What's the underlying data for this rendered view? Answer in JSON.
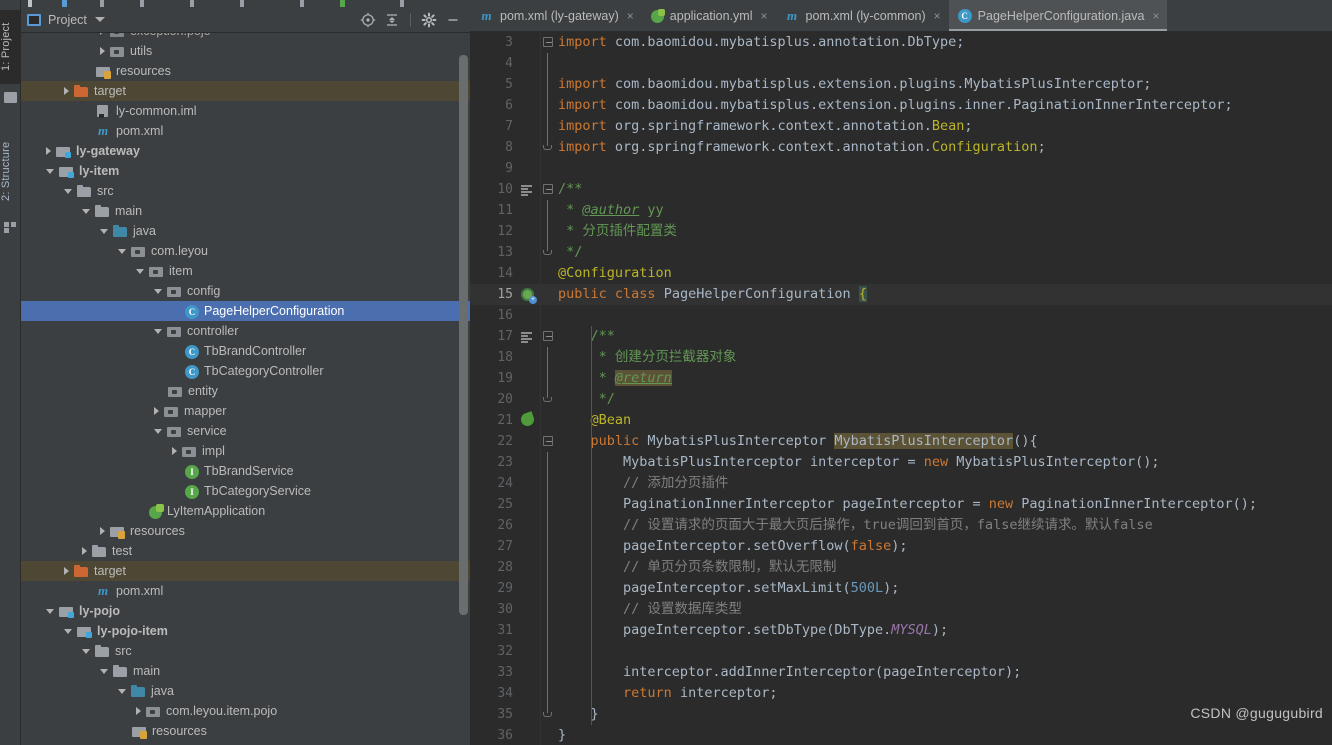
{
  "window": {
    "left_tool_strip": [
      {
        "label": "1: Project",
        "active": true,
        "icon": "project-icon"
      },
      {
        "label": "2: Structure",
        "active": false,
        "icon": "structure-icon"
      }
    ]
  },
  "project_panel": {
    "title": "Project",
    "dropdown_icon": "chevron-down-icon",
    "actions": [
      {
        "name": "locate-icon",
        "title": "Select Opened File"
      },
      {
        "name": "collapse-all-icon",
        "title": "Collapse All"
      },
      {
        "name": "gear-icon",
        "title": "Settings"
      },
      {
        "name": "minimize-icon",
        "title": "Hide"
      }
    ],
    "tree": [
      {
        "label": "exception.pojo",
        "indent": 4,
        "arrow": "right",
        "icon": "package",
        "clipped": true
      },
      {
        "label": "utils",
        "indent": 4,
        "arrow": "right",
        "icon": "package"
      },
      {
        "label": "resources",
        "indent": 3,
        "arrow": "none",
        "icon": "resources-folder"
      },
      {
        "label": "target",
        "indent": 2,
        "arrow": "right",
        "icon": "folder-orange",
        "highlight": "target"
      },
      {
        "label": "ly-common.iml",
        "indent": 3,
        "arrow": "none",
        "icon": "iml"
      },
      {
        "label": "pom.xml",
        "indent": 3,
        "arrow": "none",
        "icon": "maven"
      },
      {
        "label": "ly-gateway",
        "indent": 1,
        "arrow": "right",
        "icon": "module",
        "bold": true
      },
      {
        "label": "ly-item",
        "indent": 1,
        "arrow": "down",
        "icon": "module",
        "bold": true
      },
      {
        "label": "src",
        "indent": 2,
        "arrow": "down",
        "icon": "folder"
      },
      {
        "label": "main",
        "indent": 3,
        "arrow": "down",
        "icon": "folder"
      },
      {
        "label": "java",
        "indent": 4,
        "arrow": "down",
        "icon": "folder-blue"
      },
      {
        "label": "com.leyou",
        "indent": 5,
        "arrow": "down",
        "icon": "package"
      },
      {
        "label": "item",
        "indent": 6,
        "arrow": "down",
        "icon": "package"
      },
      {
        "label": "config",
        "indent": 7,
        "arrow": "down",
        "icon": "package"
      },
      {
        "label": "PageHelperConfiguration",
        "indent": 8,
        "arrow": "none",
        "icon": "class",
        "selected": true
      },
      {
        "label": "controller",
        "indent": 7,
        "arrow": "down",
        "icon": "package"
      },
      {
        "label": "TbBrandController",
        "indent": 8,
        "arrow": "none",
        "icon": "class"
      },
      {
        "label": "TbCategoryController",
        "indent": 8,
        "arrow": "none",
        "icon": "class"
      },
      {
        "label": "entity",
        "indent": 7,
        "arrow": "none",
        "icon": "package"
      },
      {
        "label": "mapper",
        "indent": 7,
        "arrow": "right",
        "icon": "package"
      },
      {
        "label": "service",
        "indent": 7,
        "arrow": "down",
        "icon": "package"
      },
      {
        "label": "impl",
        "indent": 8,
        "arrow": "right",
        "icon": "package"
      },
      {
        "label": "TbBrandService",
        "indent": 8,
        "arrow": "none",
        "icon": "interface"
      },
      {
        "label": "TbCategoryService",
        "indent": 8,
        "arrow": "none",
        "icon": "interface"
      },
      {
        "label": "LyItemApplication",
        "indent": 6,
        "arrow": "none",
        "icon": "spring-app"
      },
      {
        "label": "resources",
        "indent": 4,
        "arrow": "right",
        "icon": "resources-folder"
      },
      {
        "label": "test",
        "indent": 3,
        "arrow": "right",
        "icon": "folder"
      },
      {
        "label": "target",
        "indent": 2,
        "arrow": "right",
        "icon": "folder-orange",
        "highlight": "target"
      },
      {
        "label": "pom.xml",
        "indent": 3,
        "arrow": "none",
        "icon": "maven"
      },
      {
        "label": "ly-pojo",
        "indent": 1,
        "arrow": "down",
        "icon": "module",
        "bold": true
      },
      {
        "label": "ly-pojo-item",
        "indent": 2,
        "arrow": "down",
        "icon": "module",
        "bold": true
      },
      {
        "label": "src",
        "indent": 3,
        "arrow": "down",
        "icon": "folder"
      },
      {
        "label": "main",
        "indent": 4,
        "arrow": "down",
        "icon": "folder"
      },
      {
        "label": "java",
        "indent": 5,
        "arrow": "down",
        "icon": "folder-blue"
      },
      {
        "label": "com.leyou.item.pojo",
        "indent": 6,
        "arrow": "right",
        "icon": "package"
      },
      {
        "label": "resources",
        "indent": 5,
        "arrow": "none",
        "icon": "resources-folder"
      }
    ]
  },
  "editor": {
    "tabs": [
      {
        "label": "pom.xml (ly-gateway)",
        "icon": "maven-icon",
        "active": false,
        "close": "×"
      },
      {
        "label": "application.yml",
        "icon": "spring-yaml-icon",
        "active": false,
        "close": "×"
      },
      {
        "label": "pom.xml (ly-common)",
        "icon": "maven-icon",
        "active": false,
        "close": "×"
      },
      {
        "label": "PageHelperConfiguration.java",
        "icon": "java-class-icon",
        "active": true,
        "close": "×"
      }
    ],
    "first_line_number": 3,
    "current_line": 15,
    "lines": [
      {
        "n": 3,
        "text": "import com.baomidou.mybatisplus.annotation.DbType;"
      },
      {
        "n": 4,
        "text": ""
      },
      {
        "n": 5,
        "text": "import com.baomidou.mybatisplus.extension.plugins.MybatisPlusInterceptor;"
      },
      {
        "n": 6,
        "text": "import com.baomidou.mybatisplus.extension.plugins.inner.PaginationInnerInterceptor;"
      },
      {
        "n": 7,
        "text": "import org.springframework.context.annotation.Bean;"
      },
      {
        "n": 8,
        "text": "import org.springframework.context.annotation.Configuration;"
      },
      {
        "n": 9,
        "text": ""
      },
      {
        "n": 10,
        "text": "/**"
      },
      {
        "n": 11,
        "text": " * @author yy"
      },
      {
        "n": 12,
        "text": " * 分页插件配置类"
      },
      {
        "n": 13,
        "text": " */"
      },
      {
        "n": 14,
        "text": "@Configuration"
      },
      {
        "n": 15,
        "text": "public class PageHelperConfiguration {"
      },
      {
        "n": 16,
        "text": ""
      },
      {
        "n": 17,
        "text": "    /**"
      },
      {
        "n": 18,
        "text": "     * 创建分页拦截器对象"
      },
      {
        "n": 19,
        "text": "     * @return"
      },
      {
        "n": 20,
        "text": "     */"
      },
      {
        "n": 21,
        "text": "    @Bean"
      },
      {
        "n": 22,
        "text": "    public MybatisPlusInterceptor MybatisPlusInterceptor(){"
      },
      {
        "n": 23,
        "text": "        MybatisPlusInterceptor interceptor = new MybatisPlusInterceptor();"
      },
      {
        "n": 24,
        "text": "        // 添加分页插件"
      },
      {
        "n": 25,
        "text": "        PaginationInnerInterceptor pageInterceptor = new PaginationInnerInterceptor();"
      },
      {
        "n": 26,
        "text": "        // 设置请求的页面大于最大页后操作，true调回到首页，false继续请求。默认false"
      },
      {
        "n": 27,
        "text": "        pageInterceptor.setOverflow(false);"
      },
      {
        "n": 28,
        "text": "        // 单页分页条数限制，默认无限制"
      },
      {
        "n": 29,
        "text": "        pageInterceptor.setMaxLimit(500L);"
      },
      {
        "n": 30,
        "text": "        // 设置数据库类型"
      },
      {
        "n": 31,
        "text": "        pageInterceptor.setDbType(DbType.MYSQL);"
      },
      {
        "n": 32,
        "text": ""
      },
      {
        "n": 33,
        "text": "        interceptor.addInnerInterceptor(pageInterceptor);"
      },
      {
        "n": 34,
        "text": "        return interceptor;"
      },
      {
        "n": 35,
        "text": "    }"
      },
      {
        "n": 36,
        "text": "}"
      }
    ],
    "gutter_markers": [
      {
        "line": 15,
        "name": "spring-bean-component-marker"
      },
      {
        "line": 21,
        "name": "spring-bean-marker"
      },
      {
        "line": 10,
        "name": "javadoc-marker"
      },
      {
        "line": 17,
        "name": "javadoc-marker"
      }
    ]
  },
  "watermark": "CSDN @gugugubird",
  "colors": {
    "panel_bg": "#3c3f41",
    "editor_bg": "#2b2b2b",
    "selection_blue": "#4b6eaf",
    "target_highlight": "#4e4733",
    "keyword_orange": "#cc7832",
    "string_green": "#6a8759",
    "javadoc_green": "#629755",
    "annotation_yellow": "#bbb529",
    "number_blue": "#6897bb",
    "static_field_purple": "#9876aa",
    "comment_gray": "#808080",
    "text_default": "#a9b7c6",
    "search_highlight": "#5c5235",
    "current_line": "#323232"
  }
}
